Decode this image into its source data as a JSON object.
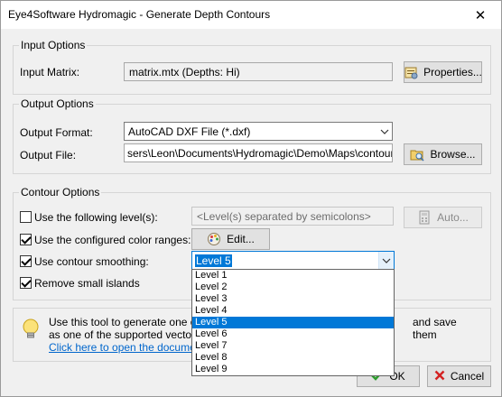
{
  "window": {
    "title": "Eye4Software Hydromagic - Generate Depth Contours"
  },
  "input_options": {
    "group_label": "Input Options",
    "matrix_label": "Input Matrix:",
    "matrix_value": "matrix.mtx (Depths: Hi)",
    "properties_button": "Properties..."
  },
  "output_options": {
    "group_label": "Output Options",
    "format_label": "Output Format:",
    "format_value": "AutoCAD DXF File (*.dxf)",
    "file_label": "Output File:",
    "file_value": "sers\\Leon\\Documents\\Hydromagic\\Demo\\Maps\\contours.dxf",
    "browse_button": "Browse..."
  },
  "contour_options": {
    "group_label": "Contour Options",
    "use_levels_label": "Use the following level(s):",
    "use_levels_checked": false,
    "levels_placeholder": "<Level(s) separated by semicolons>",
    "auto_button": "Auto...",
    "color_ranges_label": "Use the configured color ranges:",
    "color_ranges_checked": true,
    "edit_button": "Edit...",
    "smoothing_label": "Use contour smoothing:",
    "smoothing_checked": true,
    "smoothing_value": "Level 5",
    "remove_islands_label": "Remove small islands",
    "remove_islands_checked": true
  },
  "smoothing_options": [
    "Level 1",
    "Level 2",
    "Level 3",
    "Level 4",
    "Level 5",
    "Level 6",
    "Level 7",
    "Level 8",
    "Level 9"
  ],
  "smoothing_selected_index": 4,
  "info": {
    "line1_start": "Use this tool to generate one or m",
    "line1_end": "and save them",
    "line2": "as one of the supported vector m",
    "link": "Click here to open the documentat"
  },
  "footer": {
    "ok_button": "OK",
    "cancel_button": "Cancel"
  },
  "colors": {
    "selection": "#0078d7",
    "link": "#0066cc",
    "ok_check": "#2e9d2e",
    "cancel_x": "#d32222"
  }
}
